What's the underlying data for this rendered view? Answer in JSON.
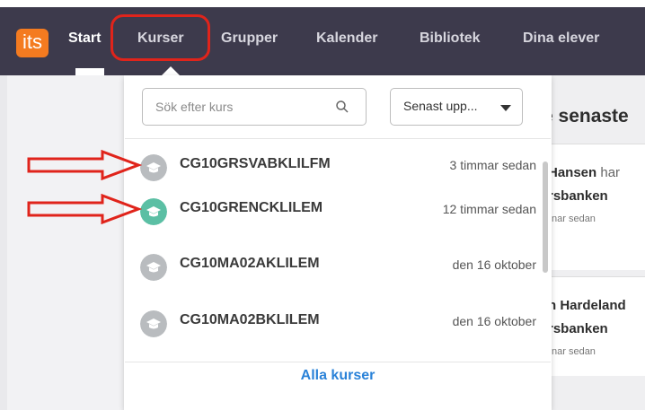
{
  "nav": {
    "logo_text": "its",
    "items": [
      {
        "label": "Start"
      },
      {
        "label": "Kurser"
      },
      {
        "label": "Grupper"
      },
      {
        "label": "Kalender"
      },
      {
        "label": "Bibliotek"
      },
      {
        "label": "Dina elever"
      }
    ]
  },
  "dropdown": {
    "search_placeholder": "Sök efter kurs",
    "sort_label": "Senast upp...",
    "courses": [
      {
        "name": "CG10GRSVABKLILFM",
        "time": "3 timmar sedan",
        "avatar_color": "#b9bcbf"
      },
      {
        "name": "CG10GRENCKLILEM",
        "time": "12 timmar sedan",
        "avatar_color": "#5bbfa4"
      },
      {
        "name": "CG10MA02AKLILEM",
        "time": "den 16 oktober",
        "avatar_color": "#b9bcbf"
      },
      {
        "name": "CG10MA02BKLILEM",
        "time": "den 16 oktober",
        "avatar_color": "#b9bcbf"
      }
    ],
    "all_courses_label": "Alla kurser"
  },
  "right_panel": {
    "heading": "e senaste",
    "entries": [
      {
        "name": "Hansen",
        "suffix": "har",
        "source": "rsbanken",
        "time": "nar sedan"
      },
      {
        "name": "n Hardeland",
        "suffix": "",
        "source": "rsbanken",
        "time": "nar sedan"
      }
    ]
  },
  "colors": {
    "nav_bg": "#3d3a4c",
    "logo": "#f47b20",
    "link": "#2a82d8",
    "annotation_red": "#e0241b"
  }
}
